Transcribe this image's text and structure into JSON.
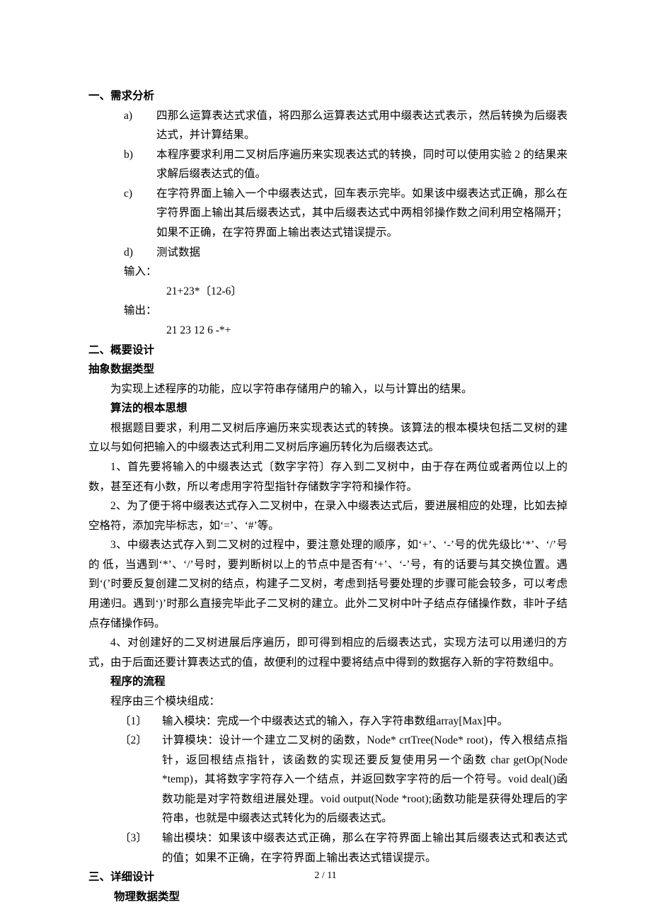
{
  "sec1": {
    "title": "一、需求分析",
    "items": [
      {
        "mark": "a)",
        "text": "四那么运算表达式求值，将四那么运算表达式用中缀表达式表示，然后转换为后缀表达式，并计算结果。"
      },
      {
        "mark": "b)",
        "text": "本程序要求利用二叉树后序遍历来实现表达式的转换，同时可以使用实验 2 的结果来求解后缀表达式的值。"
      },
      {
        "mark": "c)",
        "text": "在字符界面上输入一个中缀表达式，回车表示完毕。如果该中缀表达式正确，那么在字符界面上输出其后缀表达式，其中后缀表达式中两相邻操作数之间利用空格隔开；如果不正确，在字符界面上输出表达式错误提示。"
      },
      {
        "mark": "d)",
        "text": "测试数据"
      }
    ],
    "input_label": "输入：",
    "input_val": "21+23*〔12-6〕",
    "output_label": "输出：",
    "output_val": "21 23 12 6 -*+"
  },
  "sec2": {
    "title": "二、概要设计",
    "sub1_title": "抽象数据类型",
    "sub1_p1": "为实现上述程序的功能，应以字符串存储用户的输入，以与计算出的结果。",
    "sub2_title": "算法的根本思想",
    "sub2_p1": "根据题目要求，利用二叉树后序遍历来实现表达式的转换。该算法的根本模块包括二叉树的建立以与如何把输入的中缀表达式利用二叉树后序遍历转化为后缀表达式。",
    "sub2_p2": "1、首先要将输入的中缀表达式〔数字字符〕存入到二叉树中，由于存在两位或者两位以上的数，甚至还有小数，所以考虑用字符型指针存储数字字符和操作符。",
    "sub2_p3": "2、为了便于将中缀表达式存入二叉树中，在录入中缀表达式后，要进展相应的处理，比如去掉空格符，添加完毕标志，如‘=’、‘#’等。",
    "sub2_p4": "3、中缀表达式存入到二叉树的过程中，要注意处理的顺序，如‘+’、‘-’号的优先级比‘*’、‘/’号的 低，当遇到‘*’、‘/’号时，要判断树以上的节点中是否有‘+’、‘-’号，有的话要与其交换位置。遇到‘(’时要反复创建二叉树的结点，构建子二叉树，考虑到括号要处理的步骤可能会较多，可以考虑用递归。遇到‘)’时那么直接完毕此子二叉树的建立。此外二叉树中叶子结点存储操作数，非叶子结点存储操作码。",
    "sub2_p5": "4、对创建好的二叉树进展后序遍历，即可得到相应的后缀表达式，实现方法可以用递归的方式，由于后面还要计算表达式的值，故便利的过程中要将结点中得到的数据存入新的字符数组中。",
    "sub3_title": "程序的流程",
    "sub3_p1": "程序由三个模块组成：",
    "mods": [
      {
        "mark": "〔1〕",
        "text": "输入模块：完成一个中缀表达式的输入，存入字符串数组array[Max]中。"
      },
      {
        "mark": "〔2〕",
        "text": "计算模块：设计一个建立二叉树的函数，Node* crtTree(Node* root)，传入根结点指针，返回根结点指针，该函数的实现还要反复使用另一个函数    char getOp(Node *temp)，其将数字字符存入一个结点，并返回数字字符的后一个符号。void deal()函数功能是对字符数组进展处理。void output(Node *root);函数功能是获得处理后的字符串，也就是中缀表达式转化为的后缀表达式。"
      },
      {
        "mark": "〔3〕",
        "text": "输出模块：如果该中缀表达式正确，那么在字符界面上输出其后缀表达式和表达式的值；如果不正确，在字符界面上输出表达式错误提示。"
      }
    ]
  },
  "sec3": {
    "title": "三、详细设计",
    "sub1_title": "物理数据类型"
  },
  "footer": "2 / 11"
}
